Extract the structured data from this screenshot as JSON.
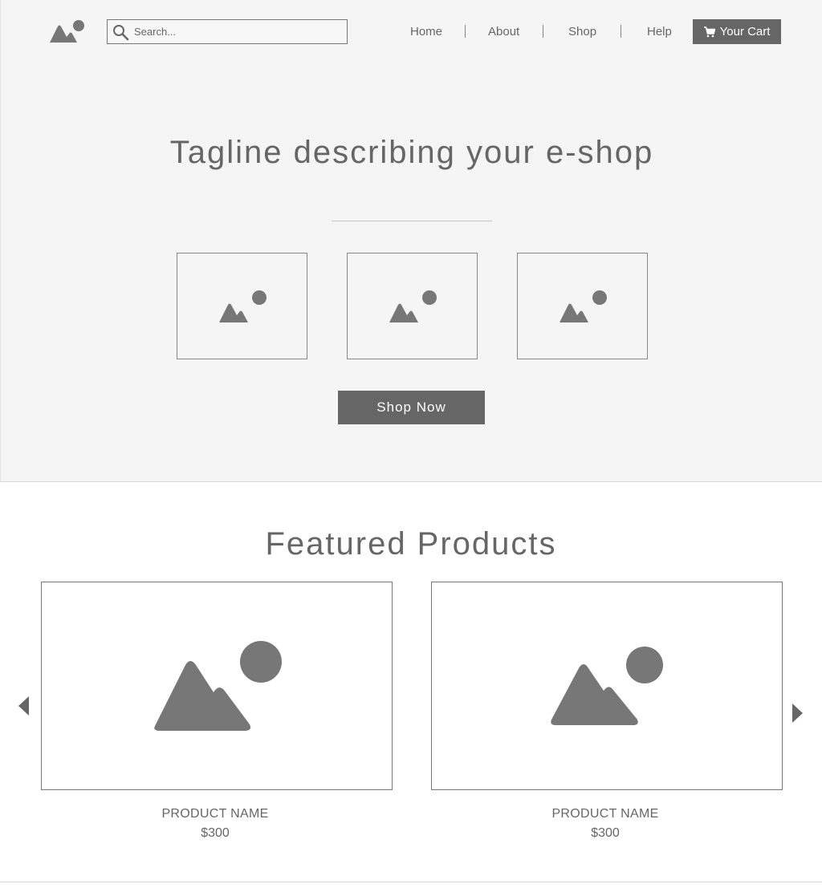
{
  "header": {
    "logo_icon": "image-placeholder-icon",
    "search": {
      "placeholder": "Search...",
      "value": "",
      "icon": "search-icon"
    },
    "nav": [
      {
        "label": "Home"
      },
      {
        "label": "About"
      },
      {
        "label": "Shop"
      },
      {
        "label": "Help"
      }
    ],
    "cart": {
      "label": "Your Cart",
      "icon": "cart-icon"
    }
  },
  "hero": {
    "tagline": "Tagline describing your e-shop",
    "thumbnails": [
      {
        "icon": "image-placeholder-icon"
      },
      {
        "icon": "image-placeholder-icon"
      },
      {
        "icon": "image-placeholder-icon"
      }
    ],
    "cta_label": "Shop Now"
  },
  "featured": {
    "title": "Featured Products",
    "prev_icon": "arrow-left-icon",
    "next_icon": "arrow-right-icon",
    "products": [
      {
        "name": "PRODUCT NAME",
        "price": "$300",
        "icon": "image-placeholder-icon"
      },
      {
        "name": "PRODUCT NAME",
        "price": "$300",
        "icon": "image-placeholder-icon"
      }
    ]
  },
  "colors": {
    "hero_background": "#f5f5f5",
    "button": "#666666",
    "placeholder_icon": "#777777",
    "text": "#666666"
  }
}
